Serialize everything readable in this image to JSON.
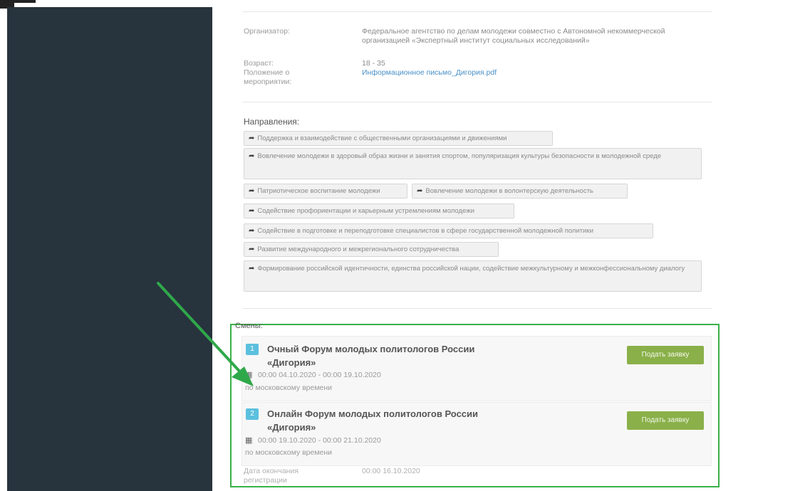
{
  "info": {
    "organizer_label": "Организатор:",
    "organizer_value": "Федеральное агентство по делам молодежи совместно с Автономной некоммерческой организацией «Экспертный институт социальных исследований»",
    "age_label": "Возраст:",
    "age_value": "18 - 35",
    "regulation_label": "Положение о мероприятии:",
    "regulation_value": "Информационное письмо_Дигория.pdf"
  },
  "directions": {
    "title": "Направления:",
    "tags": [
      "Поддержка и взаимодействие с общественными организациями и движениями",
      "Вовлечение молодежи в здоровый образ жизни и занятия спортом, популяризация культуры безопасности в молодежной среде",
      "Патриотическое воспитание молодежи",
      "Вовлечение молодежи в волонтерскую деятельность",
      "Содействие профориентации и карьерным устремлениям молодежи",
      "Содействие в подготовке и переподготовке специалистов в сфере государственной молодежной политики",
      "Развитие международного и межрегионального сотрудничества",
      "Формирование российской идентичности, единства российской нации, содействие межкультурному и межконфессиональному диалогу"
    ]
  },
  "shifts": {
    "label": "Смены:",
    "items": [
      {
        "num": "1",
        "title": "Очный Форум молодых политологов России «Дигория»",
        "dates": "00:00 04.10.2020 - 00:00 19.10.2020",
        "tz": "по московскому времени",
        "button": "Подать заявку"
      },
      {
        "num": "2",
        "title": "Онлайн Форум молодых политологов России «Дигория»",
        "dates": "00:00 19.10.2020 - 00:00 21.10.2020",
        "tz": "по московскому времени",
        "button": "Подать заявку"
      }
    ]
  },
  "deadline": {
    "label": "Дата окончания регистрации",
    "value": "00:00 16.10.2020"
  },
  "colors": {
    "sidebar": "#27333d",
    "highlight_box": "#3ab04a",
    "annotation_arrow": "#2fa84a",
    "apply_button": "#8ab04a",
    "badge": "#5bc0de",
    "link": "#4a90c8"
  },
  "icons": [
    "share-icon",
    "calendar-icon",
    "annotation-arrow"
  ]
}
